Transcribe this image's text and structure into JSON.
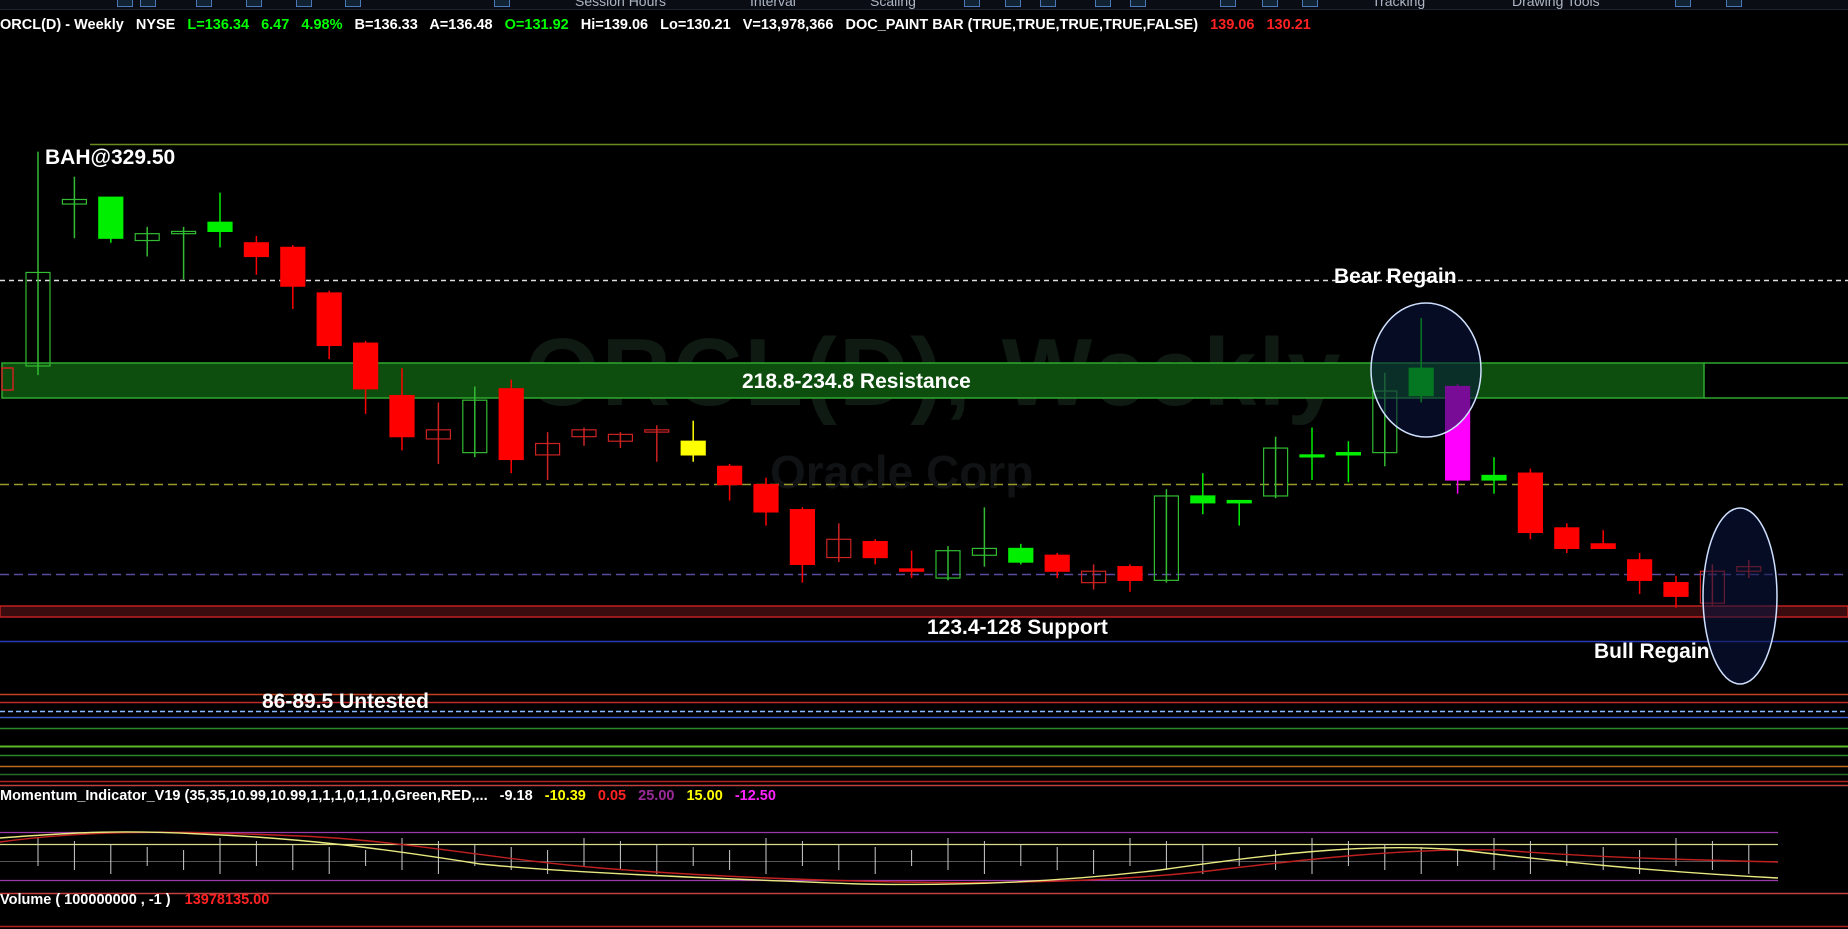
{
  "toolbar": {
    "items": [
      "Session Hours",
      "Interval",
      "Scaling",
      "Tracking",
      "Drawing Tools"
    ]
  },
  "header": {
    "symbol": "ORCL(D) - Weekly",
    "exchange": "NYSE",
    "last": "L=136.34",
    "change": "6.47",
    "change_pct": "4.98%",
    "bid": "B=136.33",
    "ask": "A=136.48",
    "open": "O=131.92",
    "high": "Hi=139.06",
    "low": "Lo=130.21",
    "volume": "V=13,978,366",
    "study": "DOC_PAINT BAR (TRUE,TRUE,TRUE,TRUE,FALSE)",
    "study_v1": "139.06",
    "study_v2": "130.21"
  },
  "watermark": {
    "line1": "ORCL(D), Weekly",
    "line2": "Oracle Corp"
  },
  "annotations": {
    "bah": "BAH@329.50",
    "bear_regain": "Bear Regain",
    "resistance": "218.8-234.8 Resistance",
    "support": "123.4-128 Support",
    "bull_regain": "Bull Regain",
    "untested": "86-89.5 Untested"
  },
  "momentum": {
    "title": "Momentum_Indicator_V19 (35,35,10.99,10.99,1,1,1,0,1,1,0,Green,RED,...",
    "v1": "-9.18",
    "v2": "-10.39",
    "v3": "0.05",
    "v4": "25.00",
    "v5": "15.00",
    "v6": "-12.50"
  },
  "volume_study": {
    "title": "Volume ( 100000000 , -1 )",
    "value": "13978135.00"
  },
  "colors": {
    "up_strong": "#00ee00",
    "down_strong": "#ff0000",
    "magenta": "#ff00ff",
    "yellow": "#ffff00",
    "up_hollow": "#33bb33",
    "down_hollow": "#cc2222",
    "resistance_zone": "#0d4d0d",
    "header_green": "#00ff00",
    "header_red": "#ff2222"
  },
  "chart_data": {
    "type": "candlestick",
    "title": "ORCL(D) - Weekly",
    "ylim": [
      60,
      345
    ],
    "candles": [
      {
        "o": 224,
        "h": 318,
        "l": 220,
        "c": 265,
        "s": "uh"
      },
      {
        "o": 295,
        "h": 307,
        "l": 280,
        "c": 297,
        "s": "uh"
      },
      {
        "o": 280,
        "h": 296,
        "l": 278,
        "c": 298,
        "s": "us"
      },
      {
        "o": 282,
        "h": 285,
        "l": 272,
        "c": 279,
        "s": "uh"
      },
      {
        "o": 282,
        "h": 285,
        "l": 262,
        "c": 283,
        "s": "uh"
      },
      {
        "o": 283,
        "h": 300,
        "l": 276,
        "c": 287,
        "s": "us"
      },
      {
        "o": 278,
        "h": 281,
        "l": 264,
        "c": 272,
        "s": "ds"
      },
      {
        "o": 276,
        "h": 277,
        "l": 249,
        "c": 259,
        "s": "ds"
      },
      {
        "o": 256,
        "h": 257,
        "l": 227,
        "c": 233,
        "s": "ds"
      },
      {
        "o": 234,
        "h": 235,
        "l": 203,
        "c": 214,
        "s": "ds"
      },
      {
        "o": 211,
        "h": 223,
        "l": 187,
        "c": 193,
        "s": "ds"
      },
      {
        "o": 196,
        "h": 208,
        "l": 181,
        "c": 192,
        "s": "dh"
      },
      {
        "o": 186,
        "h": 215,
        "l": 184,
        "c": 209,
        "s": "uh"
      },
      {
        "o": 214,
        "h": 218,
        "l": 177,
        "c": 183,
        "s": "ds"
      },
      {
        "o": 190,
        "h": 195,
        "l": 174,
        "c": 185,
        "s": "dh"
      },
      {
        "o": 196,
        "h": 197,
        "l": 189,
        "c": 193,
        "s": "dh"
      },
      {
        "o": 194,
        "h": 195,
        "l": 188,
        "c": 191,
        "s": "dh"
      },
      {
        "o": 195,
        "h": 198,
        "l": 182,
        "c": 196,
        "s": "dh"
      },
      {
        "o": 185,
        "h": 200,
        "l": 182,
        "c": 191,
        "s": "y"
      },
      {
        "o": 180,
        "h": 181,
        "l": 165,
        "c": 172,
        "s": "ds"
      },
      {
        "o": 172,
        "h": 175,
        "l": 154,
        "c": 160,
        "s": "ds"
      },
      {
        "o": 161,
        "h": 162,
        "l": 129,
        "c": 137,
        "s": "ds"
      },
      {
        "o": 140,
        "h": 155,
        "l": 138,
        "c": 148,
        "s": "dh"
      },
      {
        "o": 147,
        "h": 148,
        "l": 137,
        "c": 140,
        "s": "ds"
      },
      {
        "o": 135,
        "h": 143,
        "l": 131,
        "c": 134,
        "s": "ds"
      },
      {
        "o": 131,
        "h": 145,
        "l": 130,
        "c": 143,
        "s": "uh"
      },
      {
        "o": 141,
        "h": 162,
        "l": 136,
        "c": 144,
        "s": "uh"
      },
      {
        "o": 138,
        "h": 146,
        "l": 137,
        "c": 144,
        "s": "us"
      },
      {
        "o": 141,
        "h": 142,
        "l": 131,
        "c": 134,
        "s": "ds"
      },
      {
        "o": 129,
        "h": 137,
        "l": 126,
        "c": 134,
        "s": "dh"
      },
      {
        "o": 136,
        "h": 137,
        "l": 125,
        "c": 130,
        "s": "ds"
      },
      {
        "o": 130,
        "h": 170,
        "l": 129,
        "c": 167,
        "s": "uh"
      },
      {
        "o": 164,
        "h": 177,
        "l": 159,
        "c": 167,
        "s": "us"
      },
      {
        "o": 164,
        "h": 165,
        "l": 154,
        "c": 165,
        "s": "us"
      },
      {
        "o": 167,
        "h": 193,
        "l": 166,
        "c": 188,
        "s": "uh"
      },
      {
        "o": 185,
        "h": 197,
        "l": 174,
        "c": 185,
        "s": "us"
      },
      {
        "o": 185,
        "h": 191,
        "l": 173,
        "c": 186,
        "s": "us"
      },
      {
        "o": 186,
        "h": 221,
        "l": 180,
        "c": 213,
        "s": "uh"
      },
      {
        "o": 211,
        "h": 245,
        "l": 208,
        "c": 223,
        "s": "us"
      },
      {
        "o": 215,
        "h": 216,
        "l": 168,
        "c": 174,
        "s": "m"
      },
      {
        "o": 174,
        "h": 184,
        "l": 168,
        "c": 176,
        "s": "us"
      },
      {
        "o": 177,
        "h": 179,
        "l": 148,
        "c": 151,
        "s": "ds"
      },
      {
        "o": 153,
        "h": 155,
        "l": 142,
        "c": 144,
        "s": "ds"
      },
      {
        "o": 146,
        "h": 152,
        "l": 144,
        "c": 144,
        "s": "ds"
      },
      {
        "o": 139,
        "h": 142,
        "l": 124,
        "c": 130,
        "s": "ds"
      },
      {
        "o": 129,
        "h": 132,
        "l": 118,
        "c": 123,
        "s": "ds"
      },
      {
        "o": 120,
        "h": 137,
        "l": 119,
        "c": 134,
        "s": "dh"
      },
      {
        "o": 134,
        "h": 139,
        "l": 131,
        "c": 136,
        "s": "dh"
      }
    ]
  }
}
